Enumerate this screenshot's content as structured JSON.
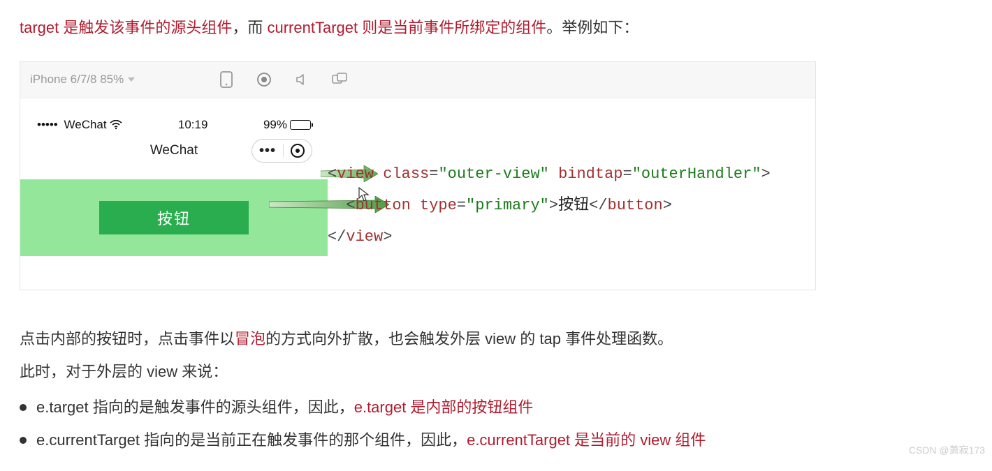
{
  "intro": {
    "p1a": "target 是触发该事件的源头组件",
    "p1b": "，而 ",
    "p1c": "currentTarget 则是当前事件所绑定的组件",
    "p1d": "。举例如下：",
    "full_plain": "target 是触发该事件的源头组件，而 currentTarget 则是当前事件所绑定的组件。举例如下："
  },
  "sim": {
    "device_label": "iPhone 6/7/8 85%",
    "status": {
      "signal_text": "•••••",
      "carrier": "WeChat",
      "time": "10:19",
      "battery_pct": "99%"
    },
    "title": "WeChat",
    "button_label": "按钮"
  },
  "code": {
    "l1_open_lt": "<",
    "l1_tag": "view",
    "l1_sp1": " ",
    "l1_a1": "class",
    "l1_eq": "=",
    "l1_v1": "\"outer-view\"",
    "l1_sp2": " ",
    "l1_a2": "bindtap",
    "l1_v2": "\"outerHandler\"",
    "l1_close": ">",
    "l2_indent": "  ",
    "l2_lt": "<",
    "l2_tag": "button",
    "l2_sp": " ",
    "l2_a1": "type",
    "l2_v1": "\"primary\"",
    "l2_gt": ">",
    "l2_text": "按钮",
    "l2_ctag_open": "</",
    "l2_ctag": "button",
    "l2_ctag_close": ">",
    "l3_ctag_open": "</",
    "l3_ctag": "view",
    "l3_ctag_close": ">"
  },
  "explain": {
    "p2a": "点击内部的按钮时，点击事件以",
    "p2b": "冒泡",
    "p2c": "的方式向外扩散，也会触发外层 view 的 tap 事件处理函数。",
    "p3": "此时，对于外层的 view 来说：",
    "li1a": "e.target 指向的是触发事件的源头组件，因此，",
    "li1b": "e.target 是内部的按钮组件",
    "li2a": "e.currentTarget 指向的是当前正在触发事件的那个组件，因此，",
    "li2b": "e.currentTarget 是当前的 view 组件"
  },
  "watermark": "CSDN @萧寂173"
}
